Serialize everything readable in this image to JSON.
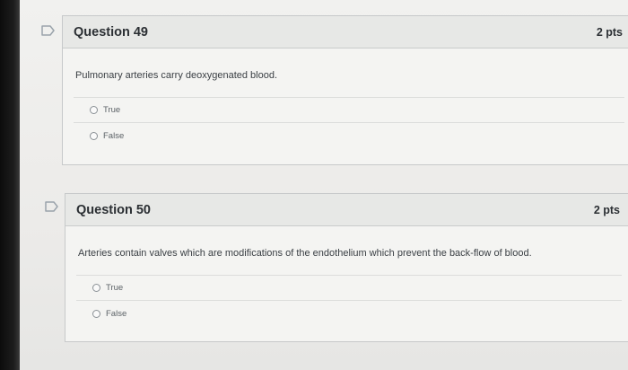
{
  "questions": [
    {
      "title": "Question 49",
      "points": "2 pts",
      "text": "Pulmonary arteries carry deoxygenated blood.",
      "answers": [
        "True",
        "False"
      ]
    },
    {
      "title": "Question 50",
      "points": "2 pts",
      "text": "Arteries contain valves which are modifications of the endothelium which prevent the back-flow of blood.",
      "answers": [
        "True",
        "False"
      ]
    }
  ],
  "icons": {
    "flag": "flag-question-icon"
  },
  "colors": {
    "header_bg": "#e7e8e6",
    "border": "#c7c9ca",
    "flag_stroke": "#9aa3ab"
  }
}
